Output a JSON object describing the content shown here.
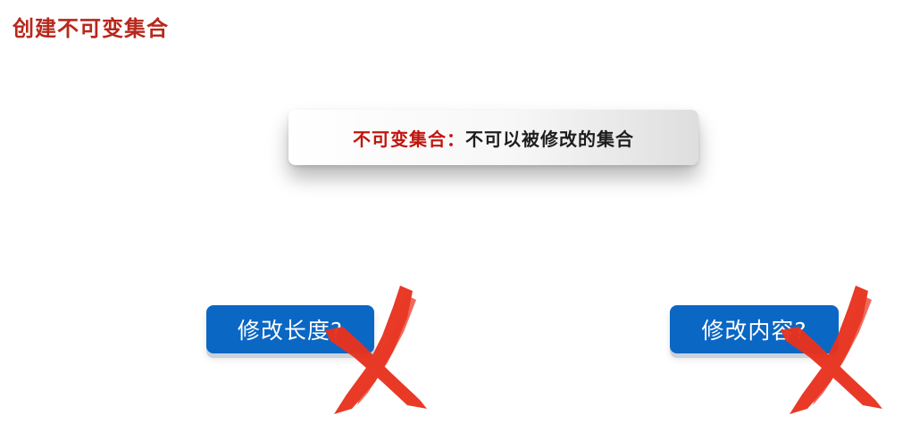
{
  "page": {
    "title": "创建不可变集合"
  },
  "definition": {
    "term": "不可变集合：",
    "text": "不可以被修改的集合"
  },
  "questions": [
    {
      "label": "修改长度?"
    },
    {
      "label": "修改内容?"
    }
  ],
  "icons": {
    "cross": "red-x-cross-icon"
  },
  "colors": {
    "title": "#b7281c",
    "term": "#c1150c",
    "button": "#0a67c4",
    "cross": "#e8321f"
  }
}
